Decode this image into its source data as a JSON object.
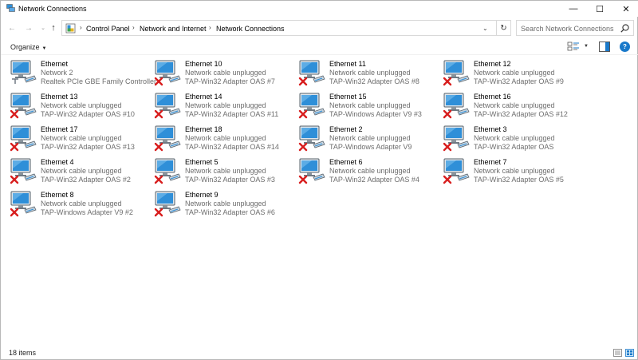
{
  "window": {
    "title": "Network Connections",
    "controls": {
      "minimize": "—",
      "maximize": "☐",
      "close": "✕"
    }
  },
  "nav": {
    "back": "←",
    "forward": "→",
    "recent": "⌄",
    "up": "↑",
    "breadcrumb": [
      "Control Panel",
      "Network and Internet",
      "Network Connections"
    ],
    "separator": "›",
    "dropdown": "⌄",
    "refresh": "↻",
    "search_placeholder": "Search Network Connections"
  },
  "toolbar": {
    "organize": "Organize",
    "organize_caret": "▼",
    "view_caret": "▼",
    "help": "?"
  },
  "items": [
    {
      "name": "Ethernet",
      "status": "Network  2",
      "device": "Realtek PCIe GBE Family Controller",
      "disconnected": false
    },
    {
      "name": "Ethernet 10",
      "status": "Network cable unplugged",
      "device": "TAP-Win32 Adapter OAS #7",
      "disconnected": true
    },
    {
      "name": "Ethernet 11",
      "status": "Network cable unplugged",
      "device": "TAP-Win32 Adapter OAS #8",
      "disconnected": true
    },
    {
      "name": "Ethernet 12",
      "status": "Network cable unplugged",
      "device": "TAP-Win32 Adapter OAS #9",
      "disconnected": true
    },
    {
      "name": "Ethernet 13",
      "status": "Network cable unplugged",
      "device": "TAP-Win32 Adapter OAS #10",
      "disconnected": true
    },
    {
      "name": "Ethernet 14",
      "status": "Network cable unplugged",
      "device": "TAP-Win32 Adapter OAS #11",
      "disconnected": true
    },
    {
      "name": "Ethernet 15",
      "status": "Network cable unplugged",
      "device": "TAP-Windows Adapter V9 #3",
      "disconnected": true
    },
    {
      "name": "Ethernet 16",
      "status": "Network cable unplugged",
      "device": "TAP-Win32 Adapter OAS #12",
      "disconnected": true
    },
    {
      "name": "Ethernet 17",
      "status": "Network cable unplugged",
      "device": "TAP-Win32 Adapter OAS #13",
      "disconnected": true
    },
    {
      "name": "Ethernet 18",
      "status": "Network cable unplugged",
      "device": "TAP-Win32 Adapter OAS #14",
      "disconnected": true
    },
    {
      "name": "Ethernet 2",
      "status": "Network cable unplugged",
      "device": "TAP-Windows Adapter V9",
      "disconnected": true
    },
    {
      "name": "Ethernet 3",
      "status": "Network cable unplugged",
      "device": "TAP-Win32 Adapter OAS",
      "disconnected": true
    },
    {
      "name": "Ethernet 4",
      "status": "Network cable unplugged",
      "device": "TAP-Win32 Adapter OAS #2",
      "disconnected": true
    },
    {
      "name": "Ethernet 5",
      "status": "Network cable unplugged",
      "device": "TAP-Win32 Adapter OAS #3",
      "disconnected": true
    },
    {
      "name": "Ethernet 6",
      "status": "Network cable unplugged",
      "device": "TAP-Win32 Adapter OAS #4",
      "disconnected": true
    },
    {
      "name": "Ethernet 7",
      "status": "Network cable unplugged",
      "device": "TAP-Win32 Adapter OAS #5",
      "disconnected": true
    },
    {
      "name": "Ethernet 8",
      "status": "Network cable unplugged",
      "device": "TAP-Windows Adapter V9 #2",
      "disconnected": true
    },
    {
      "name": "Ethernet 9",
      "status": "Network cable unplugged",
      "device": "TAP-Win32 Adapter OAS #6",
      "disconnected": true
    }
  ],
  "statusbar": {
    "count": "18 items"
  },
  "colors": {
    "accent": "#1979ca",
    "monitor_screen": "#2f8fd8",
    "error_red": "#d81e1e"
  }
}
